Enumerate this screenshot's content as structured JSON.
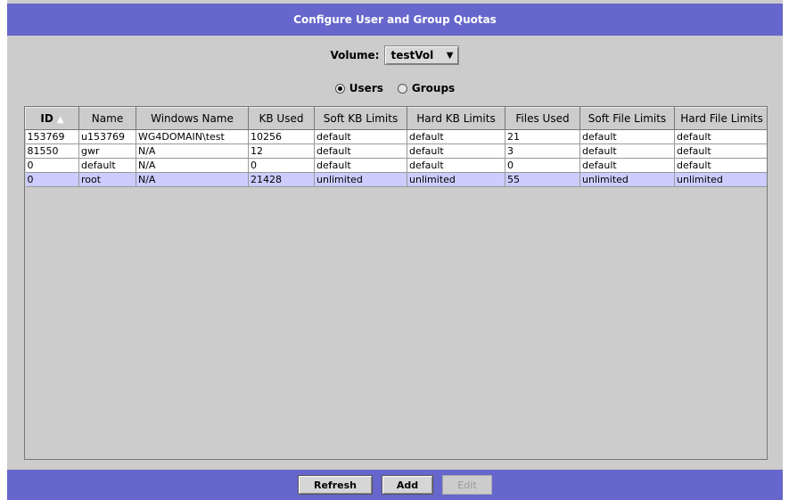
{
  "window": {
    "title": "Configure User and Group Quotas"
  },
  "volume": {
    "label": "Volume:",
    "selected": "testVol"
  },
  "quota_type": {
    "options": [
      {
        "label": "Users",
        "selected": true
      },
      {
        "label": "Groups",
        "selected": false
      }
    ]
  },
  "table": {
    "columns": [
      "ID",
      "Name",
      "Windows Name",
      "KB Used",
      "Soft KB Limits",
      "Hard KB Limits",
      "Files Used",
      "Soft File Limits",
      "Hard File Limits"
    ],
    "sort_column": "ID",
    "rows": [
      [
        "153769",
        "u153769",
        "WG4DOMAIN\\test",
        "10256",
        "default",
        "default",
        "21",
        "default",
        "default"
      ],
      [
        "81550",
        "gwr",
        "N/A",
        "12",
        "default",
        "default",
        "3",
        "default",
        "default"
      ],
      [
        "0",
        "default",
        "N/A",
        "0",
        "default",
        "default",
        "0",
        "default",
        "default"
      ],
      [
        "0",
        "root",
        "N/A",
        "21428",
        "unlimited",
        "unlimited",
        "55",
        "unlimited",
        "unlimited"
      ]
    ],
    "selected_row": 3
  },
  "buttons": {
    "refresh": "Refresh",
    "add": "Add",
    "edit": "Edit"
  },
  "colors": {
    "title_bar": "#6666cc",
    "panel": "#cccccc",
    "selected_row": "#ccccff"
  }
}
